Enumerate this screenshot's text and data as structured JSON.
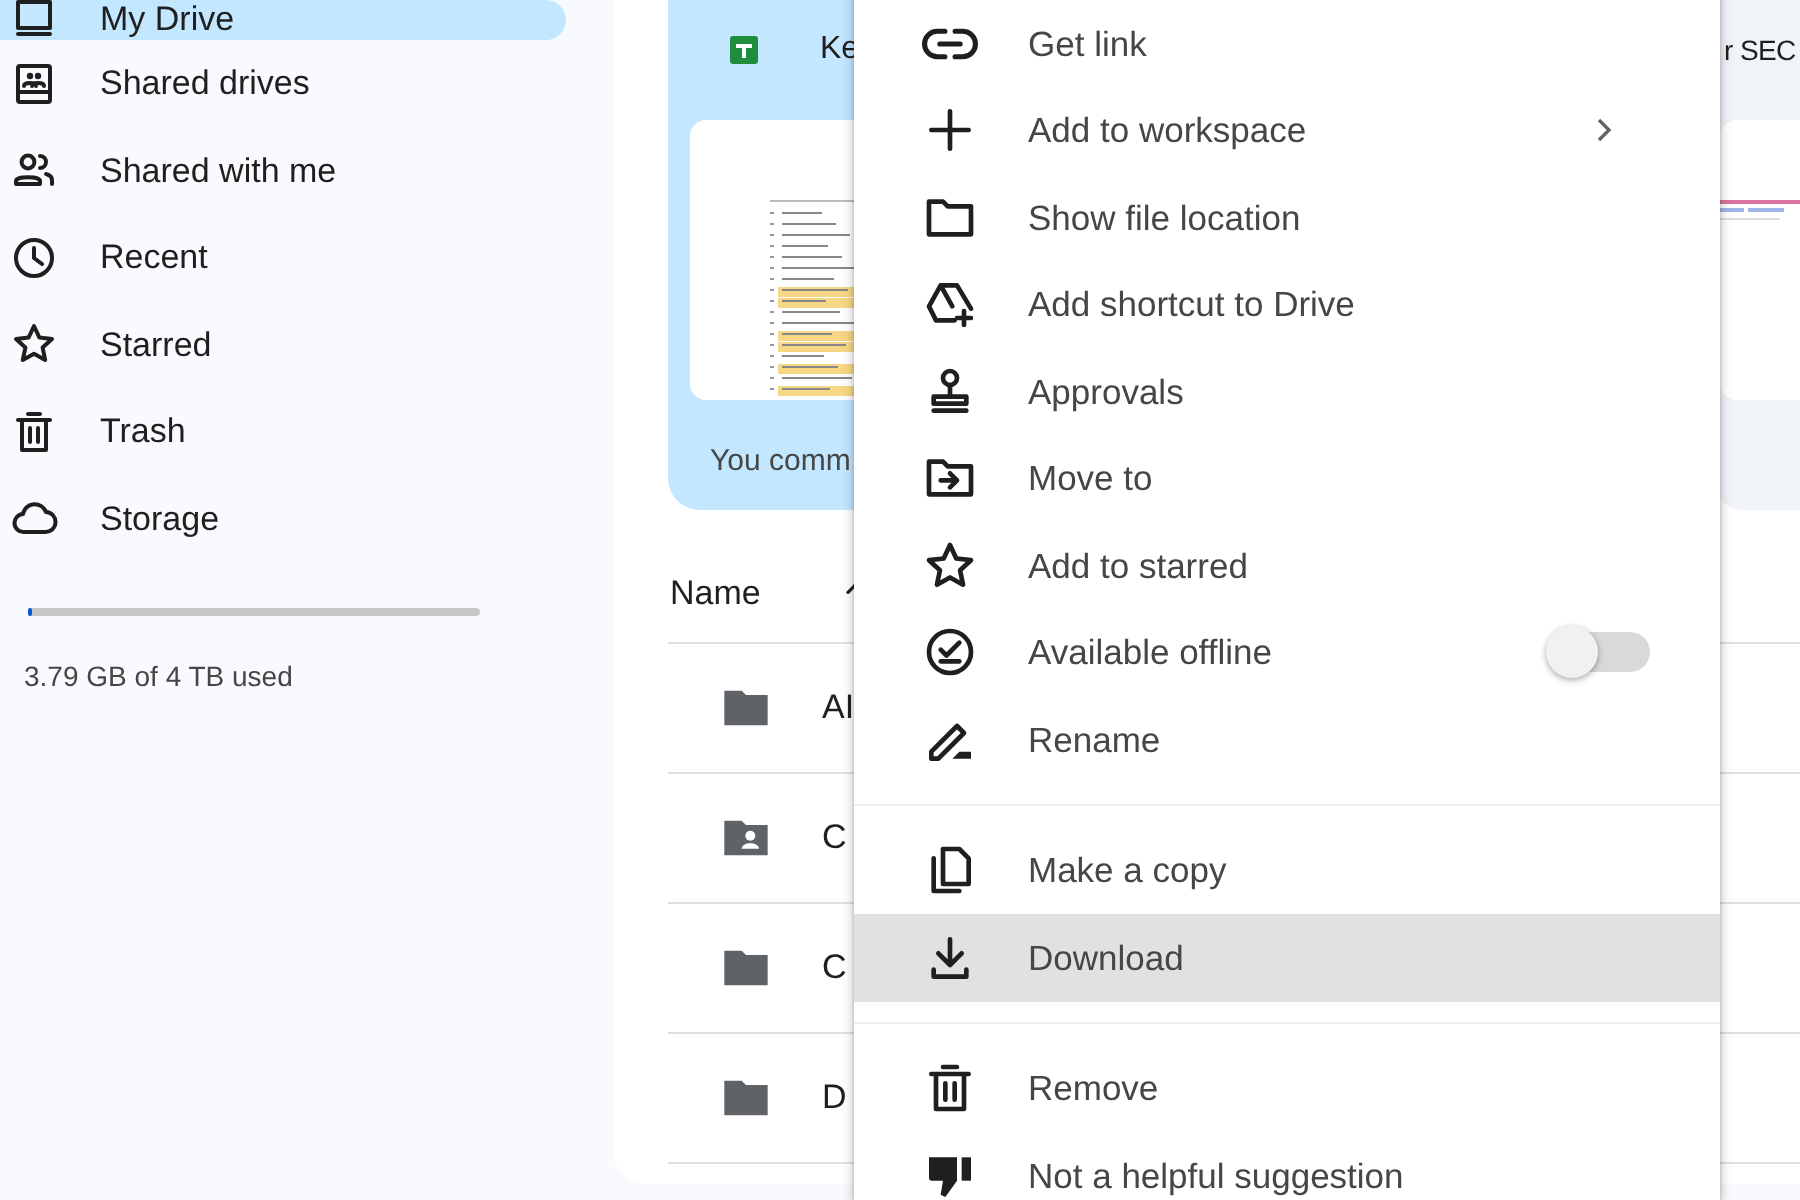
{
  "sidebar": {
    "items": [
      {
        "label": "My Drive",
        "selected": true
      },
      {
        "label": "Shared drives",
        "selected": false
      },
      {
        "label": "Shared with me",
        "selected": false
      },
      {
        "label": "Recent",
        "selected": false
      },
      {
        "label": "Starred",
        "selected": false
      },
      {
        "label": "Trash",
        "selected": false
      },
      {
        "label": "Storage",
        "selected": false
      }
    ],
    "storage": {
      "level": 0.01,
      "usage": "3.79 GB of 4 TB used"
    }
  },
  "suggested": [
    {
      "title": "Ke",
      "subtitle": "You comm",
      "selected": true
    },
    {
      "title": "r SEC",
      "selected": false
    }
  ],
  "table": {
    "columns": [
      {
        "label": "Name",
        "sorted": true
      }
    ],
    "rows": [
      {
        "name": "AI",
        "kind": "folder"
      },
      {
        "name": "C",
        "kind": "shared-folder"
      },
      {
        "name": "C",
        "kind": "folder"
      },
      {
        "name": "D",
        "kind": "folder"
      }
    ]
  },
  "context_menu": {
    "groups": [
      [
        {
          "label": "Get link",
          "selected": false
        },
        {
          "label": "Add to workspace",
          "selected": false,
          "submenu": true
        },
        {
          "label": "Show file location",
          "selected": false
        },
        {
          "label": "Add shortcut to Drive",
          "selected": false
        },
        {
          "label": "Approvals",
          "selected": false
        },
        {
          "label": "Move to",
          "selected": false
        },
        {
          "label": "Add to starred",
          "selected": false
        },
        {
          "label": "Available offline",
          "selected": false,
          "kind": "toggle",
          "on": false
        },
        {
          "label": "Rename",
          "selected": false
        }
      ],
      [
        {
          "label": "Make a copy",
          "selected": false
        },
        {
          "label": "Download",
          "selected": true
        }
      ],
      [
        {
          "label": "Remove",
          "selected": false
        },
        {
          "label": "Not a helpful suggestion",
          "selected": false
        }
      ]
    ]
  }
}
